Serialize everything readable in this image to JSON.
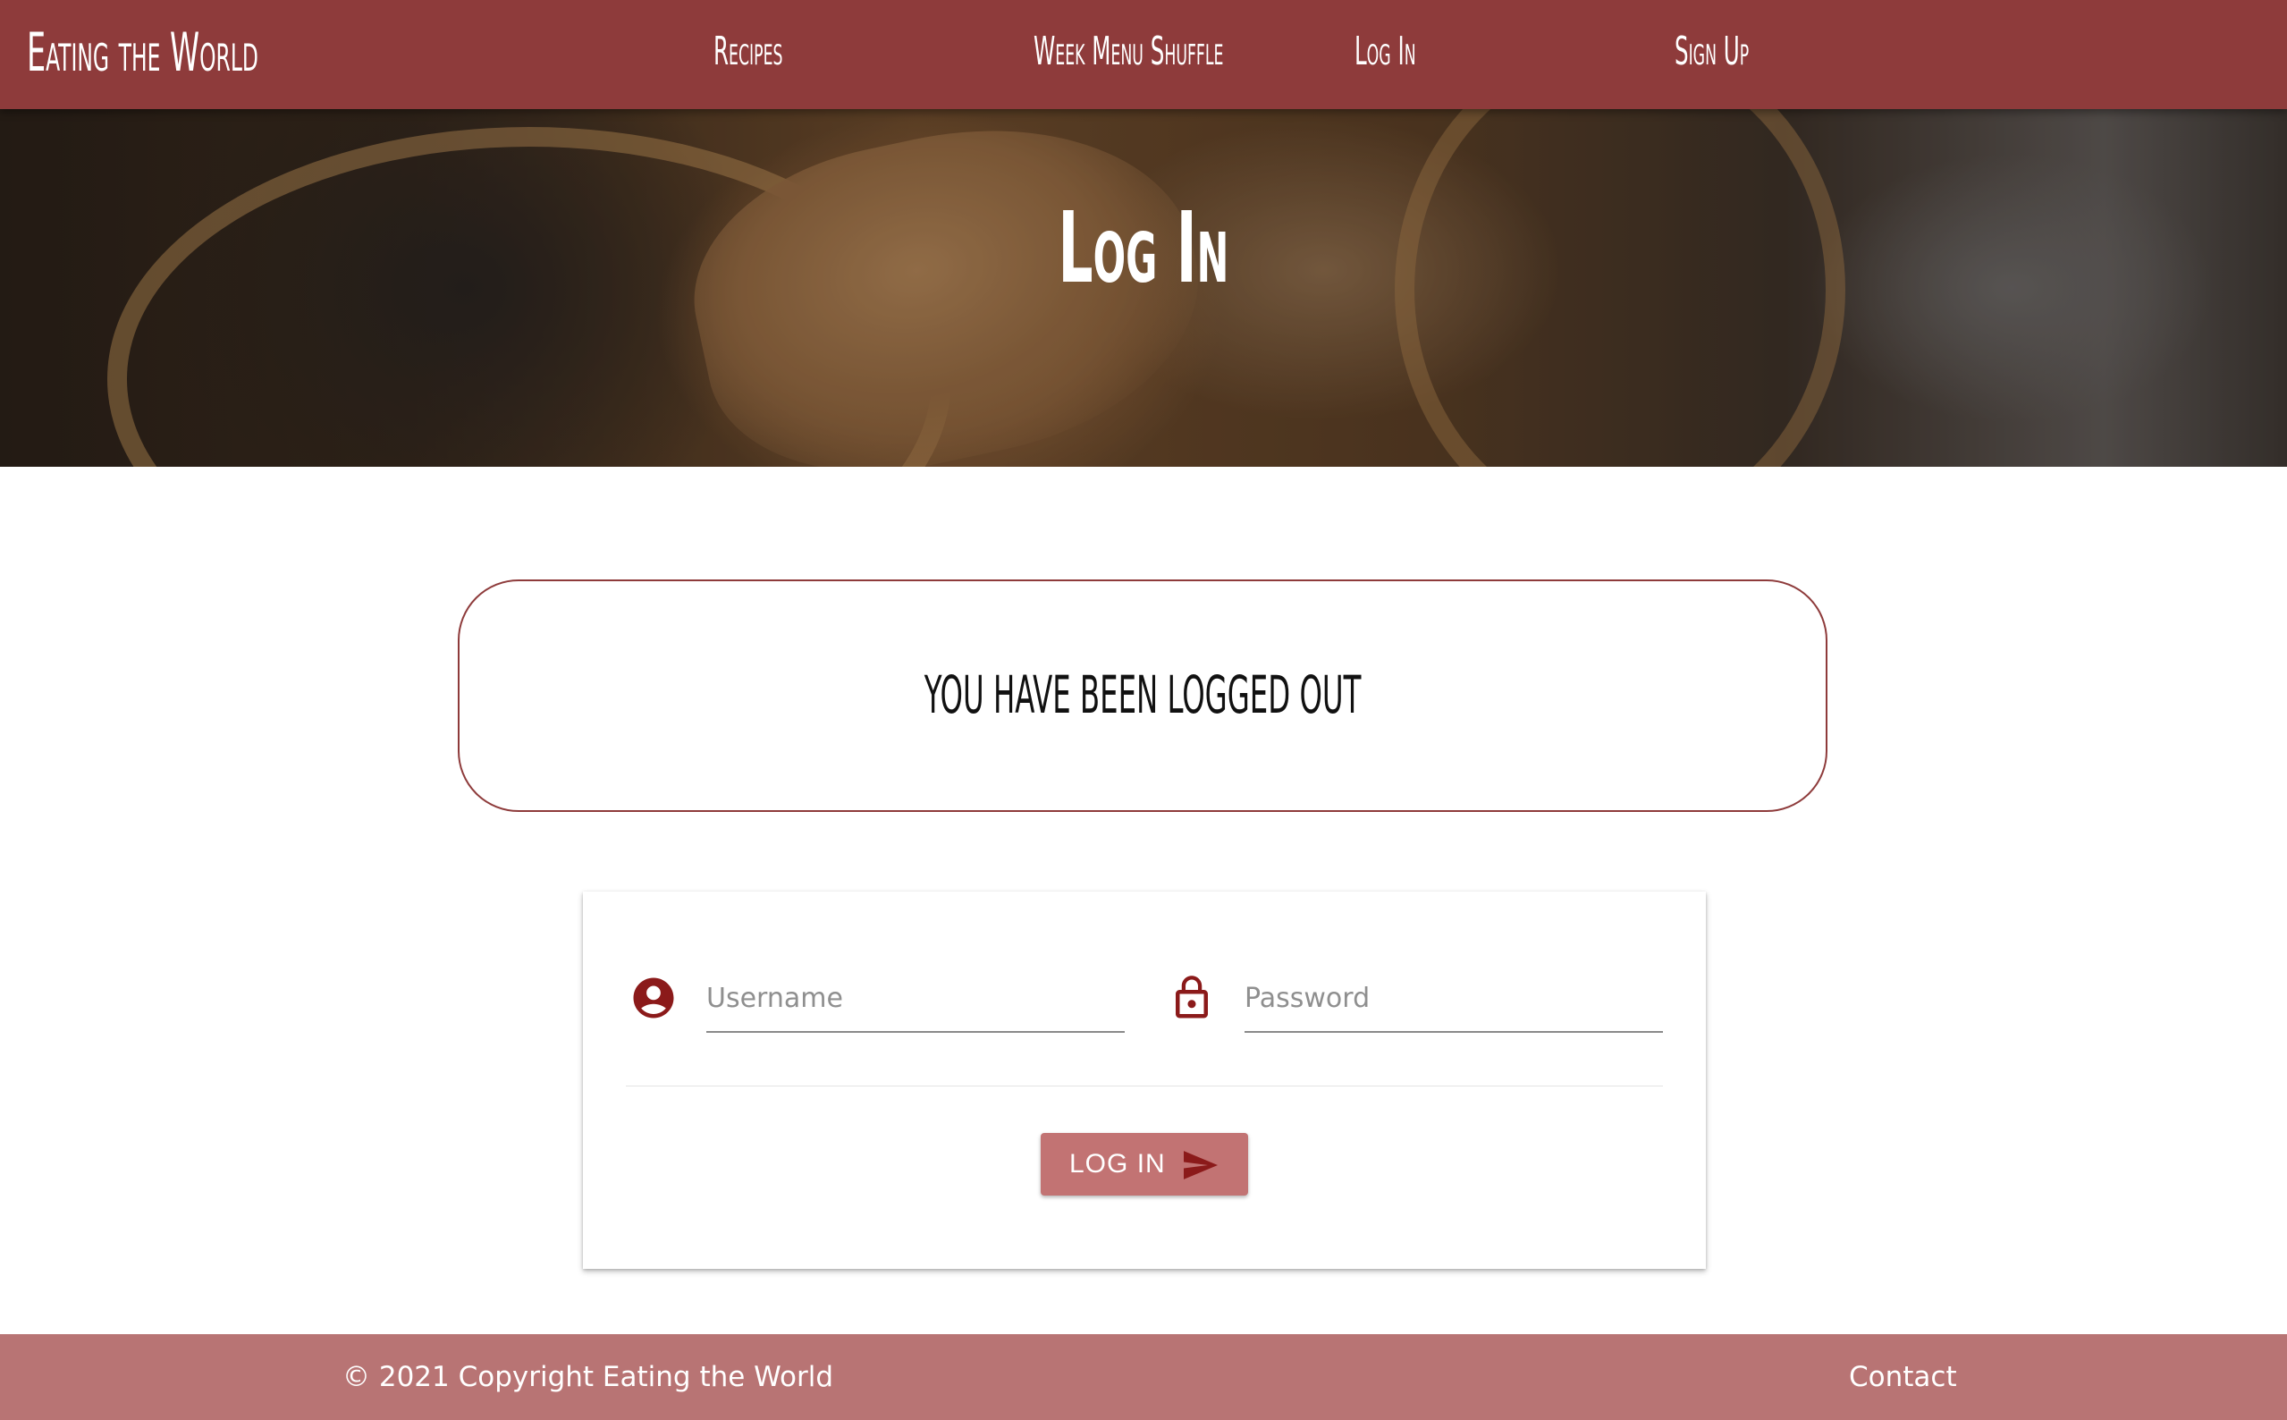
{
  "navbar": {
    "brand": "Eating the World",
    "items": [
      {
        "label": "Recipes"
      },
      {
        "label": "Week Menu Shuffle"
      },
      {
        "label": "Log In"
      },
      {
        "label": "Sign Up"
      }
    ],
    "background_color": "#8e3b3b"
  },
  "hero": {
    "title": "Log In"
  },
  "message": {
    "text": "You have been logged out"
  },
  "login_form": {
    "username_placeholder": "Username",
    "password_placeholder": "Password",
    "username_icon": "account-circle-icon",
    "password_icon": "lock-open-icon",
    "submit_label": "LOG IN",
    "submit_icon": "send-icon"
  },
  "footer": {
    "copyright": "© 2021 Copyright Eating the World",
    "contact_label": "Contact",
    "background_color": "#b87474"
  },
  "colors": {
    "accent": "#8e3b3b",
    "icon": "#8b1a1a",
    "button": "#c27373"
  }
}
